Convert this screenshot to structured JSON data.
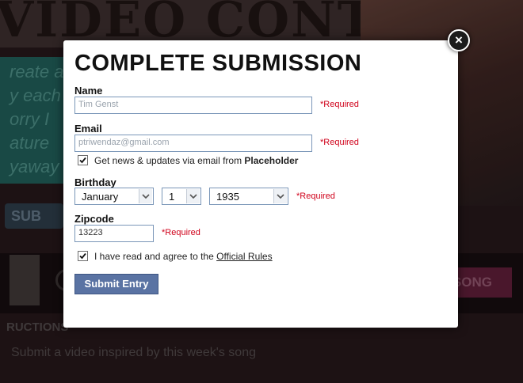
{
  "background": {
    "banner_title": "VIDEO CONTEST",
    "teal_lines": [
      "reate a",
      "y each",
      "orry I",
      "ature",
      "yaway"
    ],
    "sub_button_label": "SUB",
    "song_button_label": "SONG",
    "instructions_heading": "RUCTIONS",
    "instructions_text": "Submit a video inspired by this week's song"
  },
  "modal": {
    "title": "COMPLETE SUBMISSION",
    "close_glyph": "×",
    "required_text": "*Required",
    "name": {
      "label": "Name",
      "value": "Tim Genst"
    },
    "email": {
      "label": "Email",
      "value": "ptriwendaz@gmail.com"
    },
    "newsletter": {
      "checked": true,
      "text": "Get news & updates via email from ",
      "brand": "Placeholder"
    },
    "birthday": {
      "label": "Birthday",
      "month": "January",
      "day": "1",
      "year": "1935"
    },
    "zipcode": {
      "label": "Zipcode",
      "value": "13223"
    },
    "rules": {
      "checked": true,
      "text": "I have read and agree to the ",
      "link": "Official Rules"
    },
    "submit_label": "Submit Entry"
  },
  "colors": {
    "required": "#d0021b",
    "submit_button": "#5a73a3",
    "input_border": "#7a96b8"
  }
}
